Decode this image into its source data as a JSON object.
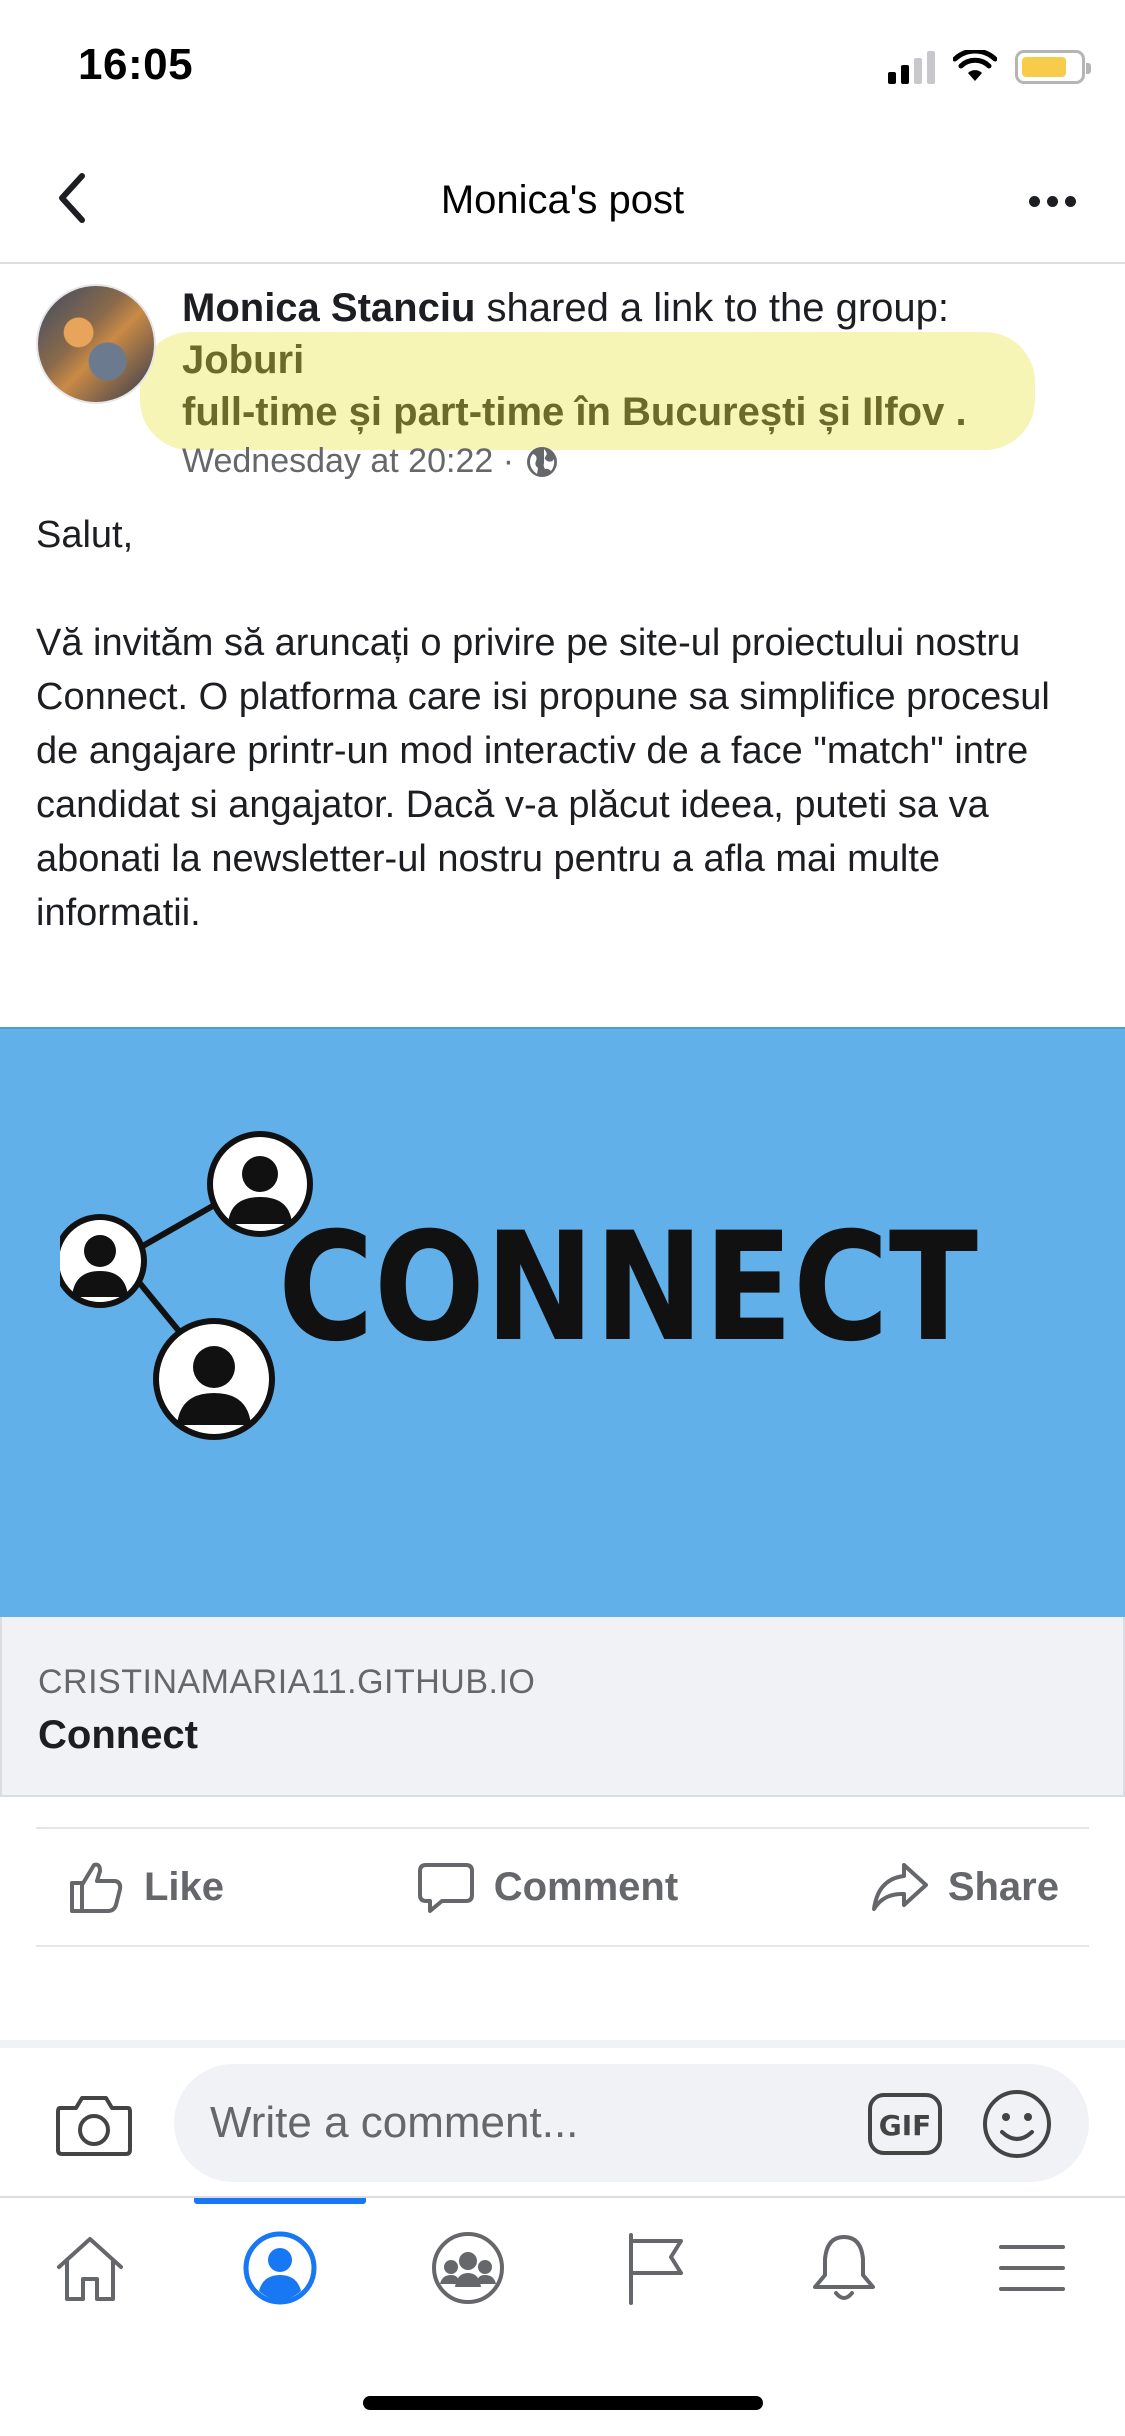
{
  "status_bar": {
    "time": "16:05",
    "icons": [
      "cellular-signal-icon",
      "wifi-icon",
      "battery-icon"
    ],
    "battery_color": "#f7cc4a"
  },
  "header": {
    "title": "Monica's post",
    "back_icon": "chevron-left-icon",
    "more_icon": "more-horizontal-icon"
  },
  "post": {
    "author": "Monica Stanciu",
    "action_text": " shared a link to the group:",
    "group_line1": "Joburi",
    "group_line2": "full-time și part-time în București și Ilfov .",
    "timestamp": "Wednesday at 20:22 ·",
    "privacy_icon": "globe-icon",
    "greeting": "Salut,",
    "body": "Vă invităm să aruncați o privire pe site-ul proiectului nostru Connect. O platforma care isi propune sa simplifice procesul de angajare printr-un mod interactiv de a face \"match\" intre candidat si angajator. Dacă v-a plăcut ideea, puteti sa va abonati la newsletter-ul nostru pentru a afla mai multe informatii."
  },
  "link_preview": {
    "image_text": "CONNECT",
    "image_bg": "#62b0ea",
    "domain": "CRISTINAMARIA11.GITHUB.IO",
    "title": "Connect"
  },
  "actions": {
    "like": "Like",
    "comment": "Comment",
    "share": "Share"
  },
  "comment_bar": {
    "placeholder": "Write a comment...",
    "gif_label": "GIF"
  },
  "tab_bar": {
    "tabs": [
      "home-icon",
      "profile-icon",
      "groups-icon",
      "pages-flag-icon",
      "notifications-bell-icon",
      "menu-icon"
    ],
    "active": "profile-icon",
    "accent": "#1877f2"
  }
}
